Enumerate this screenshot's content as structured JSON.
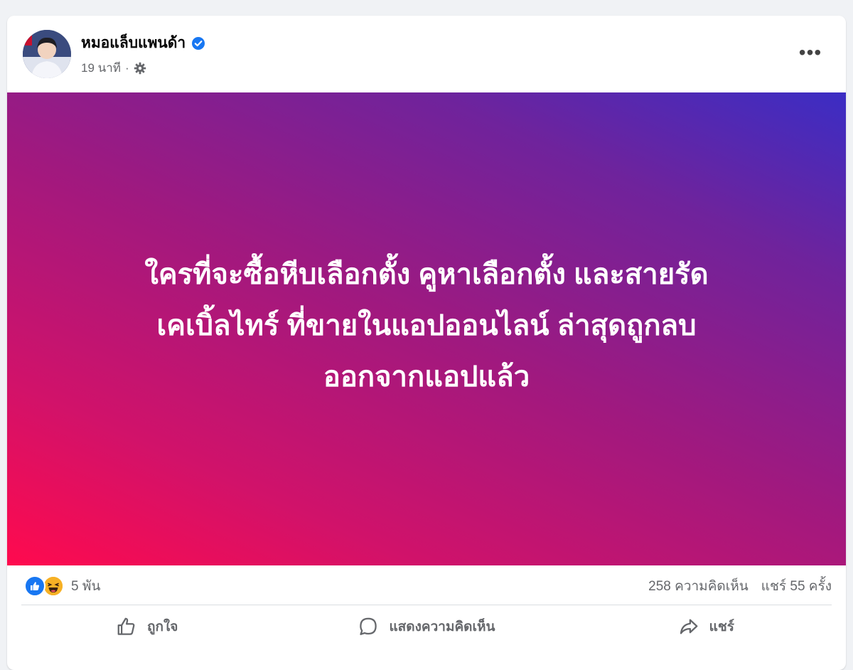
{
  "post": {
    "author": "หมอแล็บแพนด้า",
    "time": "19 นาที",
    "separator": "·",
    "more_label": "•••",
    "banner_lines": [
      "ใครที่จะซื้อหีบเลือกตั้ง คูหาเลือกตั้ง และสายรัด",
      "เคเบิ้ลไทร์ ที่ขายในแอปออนไลน์ ล่าสุดถูกลบ",
      "ออกจากแอปแล้ว"
    ],
    "banner_gradient": [
      "#ff0a4e",
      "#a0197f",
      "#3b2dc4"
    ]
  },
  "reactions": {
    "icons": [
      "like-icon",
      "haha-icon"
    ],
    "count": "5 พัน",
    "comments": "258 ความคิดเห็น",
    "shares": "แชร์ 55 ครั้ง"
  },
  "actions": {
    "like_label": "ถูกใจ",
    "comment_label": "แสดงความคิดเห็น",
    "share_label": "แชร์"
  },
  "colors": {
    "accent": "#1877f2",
    "secondary_text": "#65676b"
  }
}
